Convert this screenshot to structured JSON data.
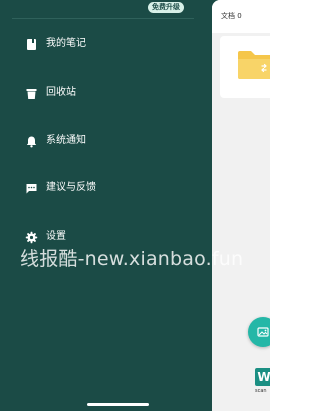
{
  "drawer": {
    "upgrade_badge": "免费升级",
    "items": [
      {
        "label": "我的笔记",
        "icon": "notebook-icon"
      },
      {
        "label": "回收站",
        "icon": "trash-icon"
      },
      {
        "label": "系统通知",
        "icon": "bell-icon"
      },
      {
        "label": "建议与反馈",
        "icon": "chat-icon"
      },
      {
        "label": "设置",
        "icon": "gear-icon"
      }
    ],
    "watermark": "线报酷-new.xianbao.fun"
  },
  "main": {
    "tab_label": "文档 0",
    "ad_logo": "W",
    "ad_text": "scan"
  },
  "colors": {
    "drawer_bg": "#1b4b46",
    "accent": "#25b7a7",
    "folder": "#f5c64a"
  }
}
